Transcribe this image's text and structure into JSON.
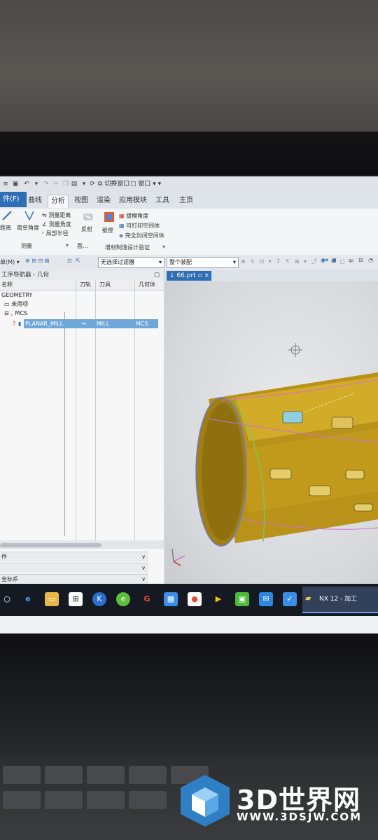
{
  "qat": {
    "switch_window": "切换窗口",
    "window_menu": "窗口"
  },
  "tabs": [
    {
      "label": "件(F)"
    },
    {
      "label": "曲线"
    },
    {
      "label": "分析"
    },
    {
      "label": "视图"
    },
    {
      "label": "渲染"
    },
    {
      "label": "应用模块"
    },
    {
      "label": "工具"
    },
    {
      "label": "主页"
    }
  ],
  "ribbon": {
    "measure_distance_big": "距离",
    "simple_angle": "简单角度",
    "measure_dist": "测量距离",
    "measure_angle": "测量角度",
    "local_radius": "局部半径",
    "group_measure": "测量",
    "reflect": "反射",
    "face_group": "面...",
    "thickness": "壁厚",
    "draft_angle": "拔模角度",
    "printable_space": "可打印空间体",
    "full_enclosed": "完全封闭空间体",
    "additive_group": "增材制造设计验证"
  },
  "cmdbar": {
    "menu": "单(M)",
    "filter": "无选择过滤器",
    "assembly": "整个装配"
  },
  "navigator": {
    "title": "工序导航器 - 几何",
    "columns": [
      "名称",
      "刀轨",
      "刀具",
      "几何体"
    ],
    "rows": [
      {
        "name": "GEOMETRY",
        "path": "",
        "tool": "",
        "geom": ""
      },
      {
        "name": "未用项",
        "path": "",
        "tool": "",
        "geom": ""
      },
      {
        "name": "MCS",
        "path": "",
        "tool": "",
        "geom": ""
      },
      {
        "name": "PLANAR_MILL",
        "path": "↪",
        "tool": "MILL",
        "geom": "MCS"
      }
    ],
    "section1": "件",
    "section2": "坐标系"
  },
  "graphics": {
    "tab_label": "66.prt"
  },
  "taskbar": {
    "nx_label": "NX 12 - 加工"
  },
  "watermark": {
    "title": "3D世界网",
    "url": "WWW.3DSJW.COM"
  },
  "colors": {
    "part_yellow": "#c8a21c",
    "selection_blue": "#6fa8d8",
    "file_tab": "#2f6db5",
    "taskbar": "#151a22"
  }
}
